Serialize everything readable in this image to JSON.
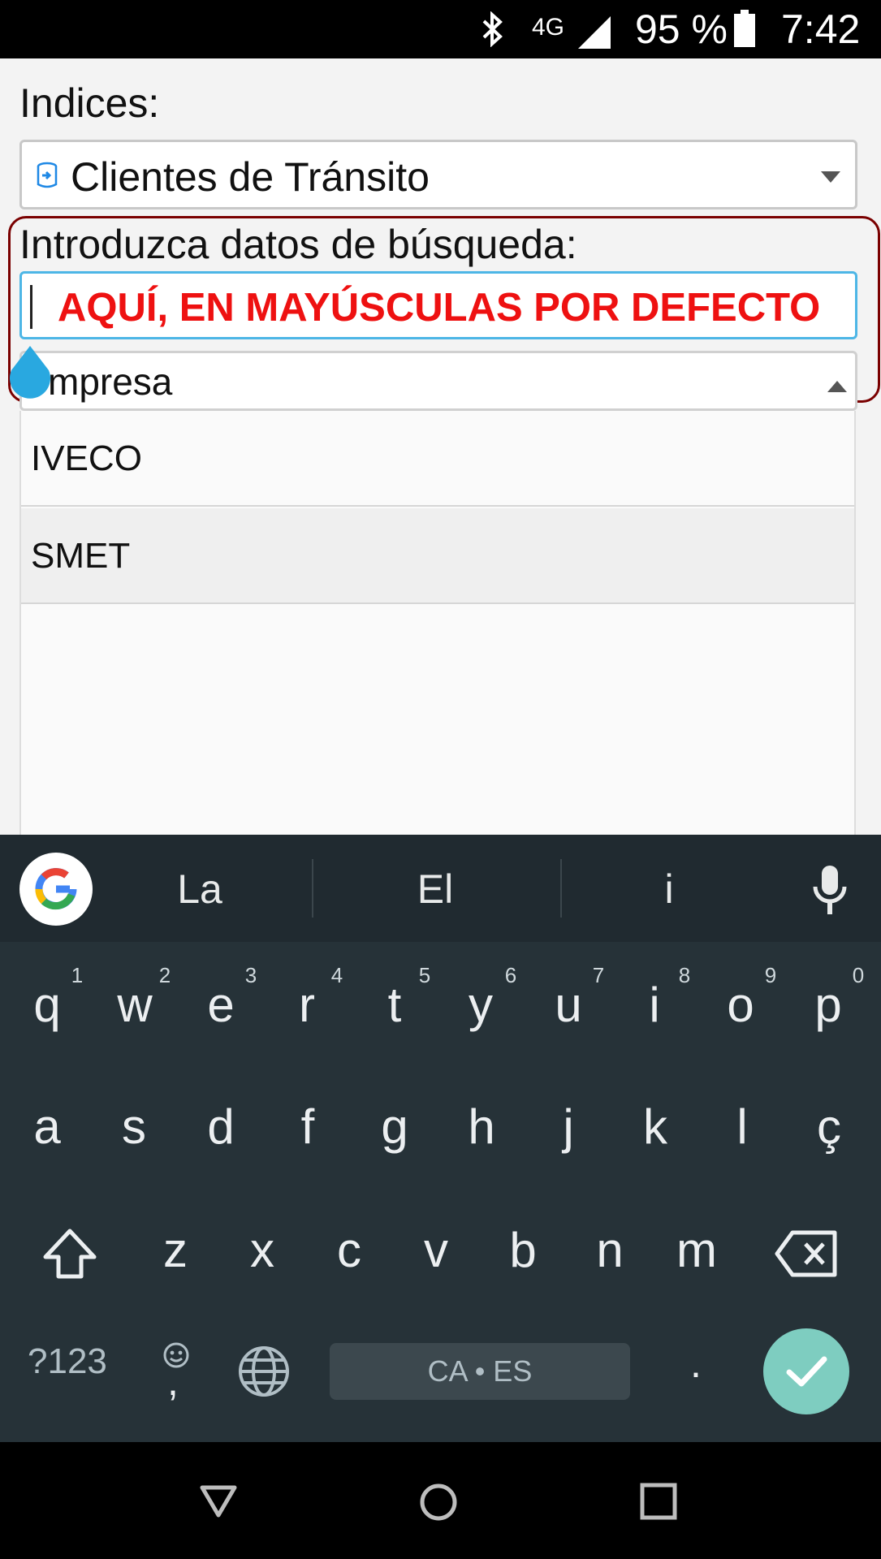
{
  "status_bar": {
    "network": "4G",
    "battery_percent": "95 %",
    "time": "7:42"
  },
  "form": {
    "indices_label": "Indices:",
    "indices_selected": "Clientes de Tránsito",
    "search_label": "Introduzca datos de búsqueda:",
    "search_annotation": "AQUÍ, EN MAYÚSCULAS POR DEFECTO",
    "field_select_value": "mpresa",
    "results": [
      "IVECO",
      "SMET"
    ]
  },
  "keyboard": {
    "suggestions": [
      "La",
      "El",
      "i"
    ],
    "row1": [
      "q",
      "w",
      "e",
      "r",
      "t",
      "y",
      "u",
      "i",
      "o",
      "p"
    ],
    "row1_hints": [
      "1",
      "2",
      "3",
      "4",
      "5",
      "6",
      "7",
      "8",
      "9",
      "0"
    ],
    "row2": [
      "a",
      "s",
      "d",
      "f",
      "g",
      "h",
      "j",
      "k",
      "l",
      "ç"
    ],
    "row3": [
      "z",
      "x",
      "c",
      "v",
      "b",
      "n",
      "m"
    ],
    "symbols_key": "?123",
    "comma_key": ",",
    "space_label": "CA • ES",
    "period_key": "."
  }
}
